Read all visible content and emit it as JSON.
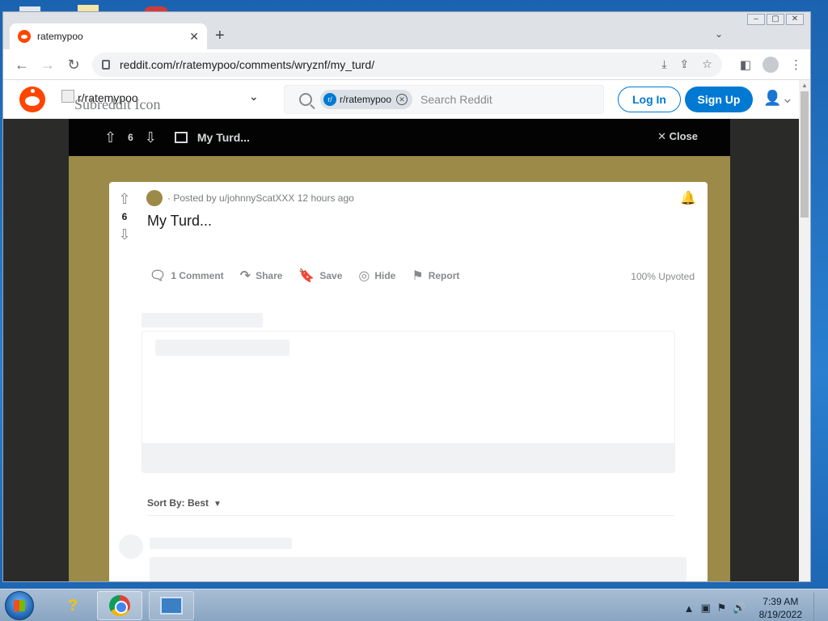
{
  "browser": {
    "tab_title": "ratemypoo",
    "tab_close": "✕",
    "new_tab": "+",
    "url": "reddit.com/r/ratemypoo/comments/wryznf/my_turd/"
  },
  "reddit_header": {
    "subreddit_name": "r/ratemypoo",
    "subreddit_icon_alt": "Subreddit Icon",
    "search_chip_label": "r/ratemypoo",
    "search_chip_icon": "r/",
    "search_placeholder": "Search Reddit",
    "login_label": "Log In",
    "signup_label": "Sign Up"
  },
  "post_bar": {
    "score": "6",
    "title": "My Turd...",
    "close_label": "Close"
  },
  "post": {
    "score": "6",
    "posted_by": "· Posted by u/johnnyScatXXX 12 hours ago",
    "title": "My Turd...",
    "comment_label": "1 Comment",
    "share_label": "Share",
    "save_label": "Save",
    "hide_label": "Hide",
    "report_label": "Report",
    "upvoted_label": "100% Upvoted",
    "sort_label": "Sort By: Best"
  },
  "taskbar": {
    "time": "7:39 AM",
    "date": "8/19/2022"
  },
  "colors": {
    "reddit_orange": "#ff4500",
    "reddit_blue": "#0079d3",
    "banner_gold": "#9c8a48"
  }
}
